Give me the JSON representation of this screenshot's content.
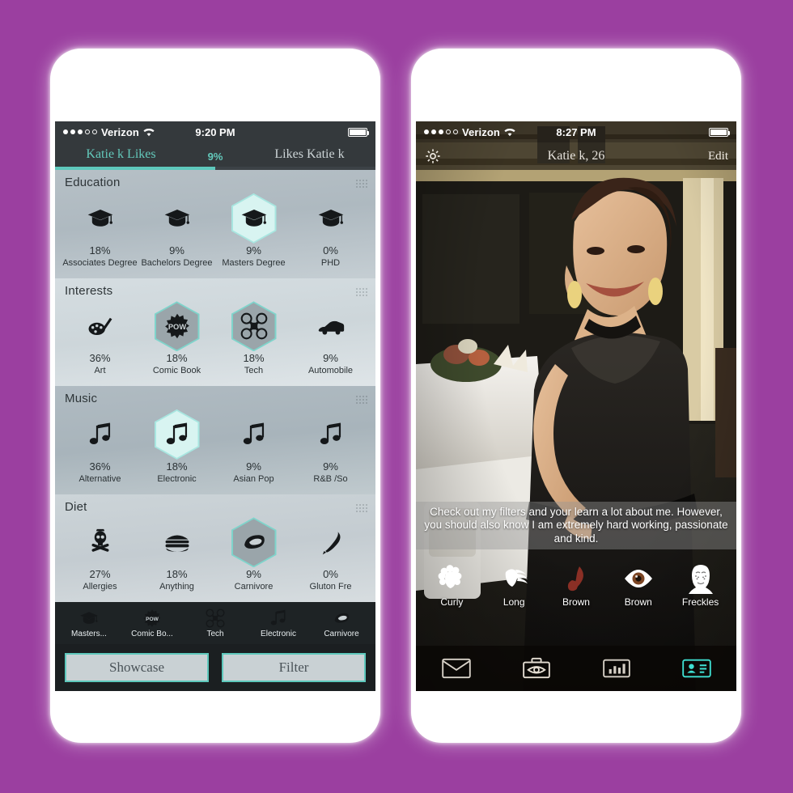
{
  "theme": {
    "background": "#9b3fa0",
    "accent_teal": "#5ec8bc",
    "accent_teal_bright": "#45e0d4",
    "dark_chrome": "#34393c"
  },
  "left_phone": {
    "status_bar": {
      "carrier": "Verizon",
      "time": "9:20 PM",
      "signal_filled": 3,
      "signal_empty": 2,
      "wifi_icon": "wifi-icon",
      "battery_icon": "battery-full-icon"
    },
    "tabs": {
      "left_label": "Katie k Likes",
      "percent_label": "9%",
      "right_label": "Likes Katie k",
      "active": "left"
    },
    "sections": [
      {
        "title": "Education",
        "tone": "tone-a",
        "items": [
          {
            "icon": "graduation-cap-icon",
            "percent": "18%",
            "label": "Associates Degree",
            "style": "plain"
          },
          {
            "icon": "graduation-cap-icon",
            "percent": "9%",
            "label": "Bachelors Degree",
            "style": "plain"
          },
          {
            "icon": "graduation-cap-icon",
            "percent": "9%",
            "label": "Masters Degree",
            "style": "glow"
          },
          {
            "icon": "graduation-cap-icon",
            "percent": "0%",
            "label": "PHD",
            "style": "plain"
          }
        ]
      },
      {
        "title": "Interests",
        "tone": "tone-b",
        "items": [
          {
            "icon": "palette-brush-icon",
            "percent": "36%",
            "label": "Art",
            "style": "plain"
          },
          {
            "icon": "pow-burst-icon",
            "percent": "18%",
            "label": "Comic Book",
            "style": "hexteal"
          },
          {
            "icon": "drone-icon",
            "percent": "18%",
            "label": "Tech",
            "style": "hexteal"
          },
          {
            "icon": "car-icon",
            "percent": "9%",
            "label": "Automobile",
            "style": "plain"
          }
        ]
      },
      {
        "title": "Music",
        "tone": "tone-c",
        "items": [
          {
            "icon": "music-note-icon",
            "percent": "36%",
            "label": "Alternative",
            "style": "plain"
          },
          {
            "icon": "music-note-icon",
            "percent": "18%",
            "label": "Electronic",
            "style": "glow"
          },
          {
            "icon": "music-note-icon",
            "percent": "9%",
            "label": "Asian Pop",
            "style": "plain"
          },
          {
            "icon": "music-note-icon",
            "percent": "9%",
            "label": "R&B /So",
            "style": "plain"
          }
        ]
      },
      {
        "title": "Diet",
        "tone": "tone-d",
        "items": [
          {
            "icon": "skull-crossbones-icon",
            "percent": "27%",
            "label": "Allergies",
            "style": "plain"
          },
          {
            "icon": "burger-icon",
            "percent": "18%",
            "label": "Anything",
            "style": "plain"
          },
          {
            "icon": "steak-icon",
            "percent": "9%",
            "label": "Carnivore",
            "style": "hexgrey"
          },
          {
            "icon": "feather-icon",
            "percent": "0%",
            "label": "Gluton Fre",
            "style": "plain"
          }
        ]
      }
    ],
    "selected_chips": [
      {
        "icon": "graduation-cap-icon",
        "label": "Masters..."
      },
      {
        "icon": "pow-burst-icon",
        "label": "Comic Bo..."
      },
      {
        "icon": "drone-icon",
        "label": "Tech"
      },
      {
        "icon": "music-note-icon",
        "label": "Electronic"
      },
      {
        "icon": "steak-icon",
        "label": "Carnivore"
      }
    ],
    "actions": {
      "showcase_label": "Showcase",
      "filter_label": "Filter"
    }
  },
  "right_phone": {
    "status_bar": {
      "carrier": "Verizon",
      "time": "8:27 PM",
      "signal_filled": 3,
      "signal_empty": 2,
      "wifi_icon": "wifi-icon",
      "battery_icon": "battery-full-icon"
    },
    "nav": {
      "settings_icon": "gear-icon",
      "title": "Katie k, 26",
      "edit_label": "Edit"
    },
    "bio": "Check out my filters and your learn a lot about me. However, you should also know I am extremely hard working, passionate and kind.",
    "traits": [
      {
        "icon": "curly-hair-icon",
        "label": "Curly"
      },
      {
        "icon": "long-hair-icon",
        "label": "Long"
      },
      {
        "icon": "hair-color-icon",
        "label": "Brown"
      },
      {
        "icon": "eye-icon",
        "label": "Brown"
      },
      {
        "icon": "freckles-face-icon",
        "label": "Freckles"
      }
    ],
    "bottom_nav": [
      {
        "icon": "envelope-icon",
        "active": false
      },
      {
        "icon": "camera-eye-icon",
        "active": false
      },
      {
        "icon": "bar-chart-icon",
        "active": false
      },
      {
        "icon": "profile-card-icon",
        "active": true
      }
    ]
  }
}
